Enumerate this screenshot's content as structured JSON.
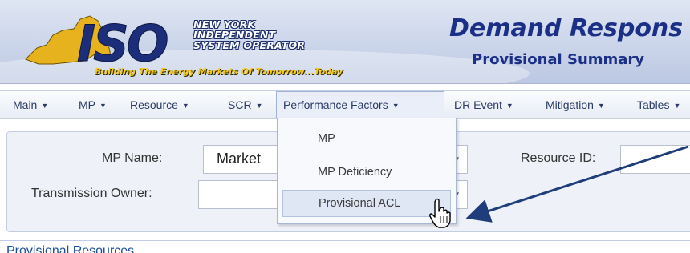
{
  "header": {
    "logo_mark": "ISO",
    "logo_lines": [
      "NEW YORK",
      "INDEPENDENT",
      "SYSTEM OPERATOR"
    ],
    "tagline": "Building The Energy Markets Of Tomorrow...Today",
    "app_title": "Demand Respons",
    "subtitle": "Provisional Summary"
  },
  "menu": {
    "items": [
      {
        "label": "Main"
      },
      {
        "label": "MP"
      },
      {
        "label": "Resource"
      },
      {
        "label": "SCR"
      },
      {
        "label": "Performance Factors"
      },
      {
        "label": "DR Event"
      },
      {
        "label": "Mitigation"
      },
      {
        "label": "Tables"
      }
    ],
    "active": "Performance Factors"
  },
  "dropdown": {
    "items": [
      {
        "label": "MP"
      },
      {
        "label": "MP Deficiency"
      },
      {
        "label": "Provisional ACL"
      }
    ],
    "hovered": "Provisional ACL"
  },
  "filters": {
    "mp_name_label": "MP Name:",
    "mp_name_value": "Market",
    "transmission_owner_label": "Transmission Owner:",
    "transmission_owner_value": "",
    "resource_id_label": "Resource ID:",
    "resource_id_value": ""
  },
  "section": {
    "title": "Provisional Resources"
  },
  "colors": {
    "brand_blue": "#1b2f86",
    "logo_yellow": "#f4c71c",
    "menu_text": "#2a3b66",
    "annotation_arrow": "#1f3d7a"
  }
}
